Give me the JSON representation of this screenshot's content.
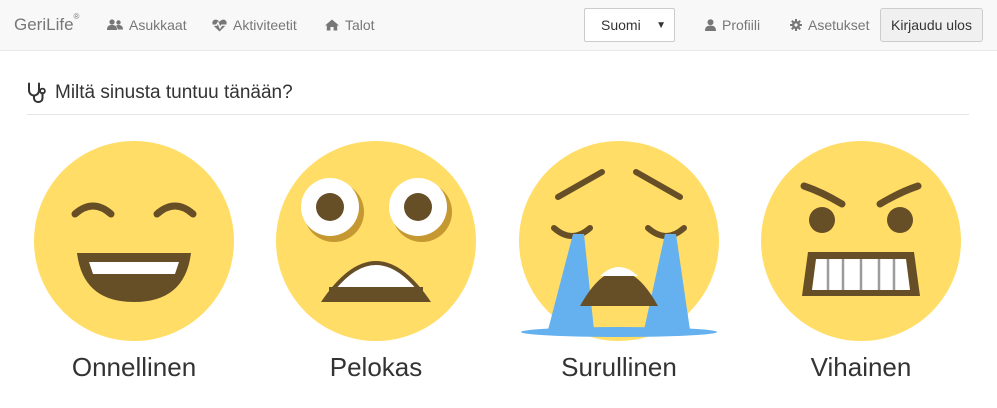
{
  "nav": {
    "brand": "GeriLife",
    "brand_mark": "®",
    "links": [
      {
        "label": "Asukkaat",
        "icon": "users-icon"
      },
      {
        "label": "Aktiviteetit",
        "icon": "heartbeat-icon"
      },
      {
        "label": "Talot",
        "icon": "home-icon"
      }
    ],
    "language": "Suomi",
    "profile": {
      "label": "Profiili",
      "icon": "user-icon"
    },
    "settings": {
      "label": "Asetukset",
      "icon": "gear-icon"
    },
    "logout": "Kirjaudu ulos"
  },
  "main": {
    "question": "Miltä sinusta tuntuu tänään?",
    "question_icon": "stethoscope-icon",
    "moods": [
      {
        "label": "Onnellinen",
        "icon": "happy-emoji-icon"
      },
      {
        "label": "Pelokas",
        "icon": "fearful-emoji-icon"
      },
      {
        "label": "Surullinen",
        "icon": "crying-emoji-icon"
      },
      {
        "label": "Vihainen",
        "icon": "angry-emoji-icon"
      }
    ]
  },
  "colors": {
    "face": "#ffdd67",
    "feature": "#664e27",
    "tear": "#65b1ef",
    "navbar_bg": "#f8f8f8"
  }
}
